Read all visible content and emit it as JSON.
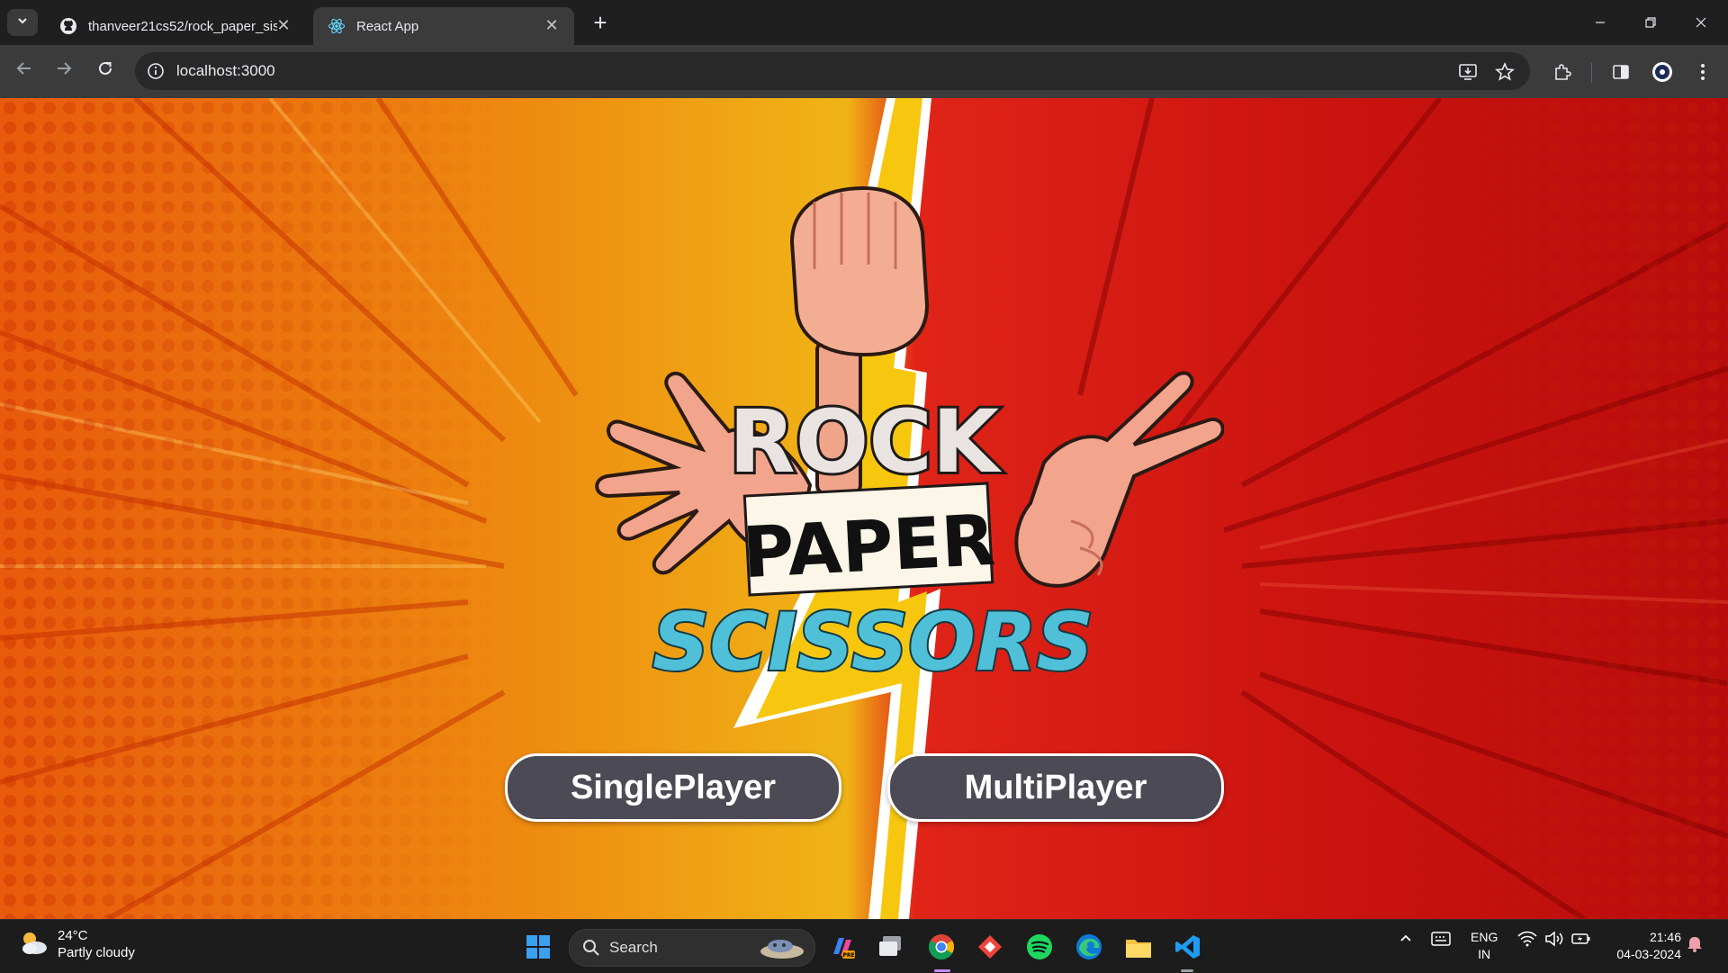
{
  "browser": {
    "tabs": [
      {
        "title": "thanveer21cs52/rock_paper_sis",
        "favicon": "github-icon",
        "active": false
      },
      {
        "title": "React App",
        "favicon": "react-icon",
        "active": true
      }
    ],
    "address": "localhost:3000"
  },
  "app": {
    "logo": {
      "line1": "ROCK",
      "line2": "PAPER",
      "line3": "SCISSORS"
    },
    "buttons": {
      "single": "SinglePlayer",
      "multi": "MultiPlayer"
    },
    "colors": {
      "left_bg": "#ee8a10",
      "right_bg": "#d01a12",
      "button_bg": "#4b4a55",
      "scissors_text": "#4fc0d8"
    }
  },
  "taskbar": {
    "weather": {
      "temp": "24°C",
      "desc": "Partly cloudy"
    },
    "search_label": "Search",
    "lang": {
      "line1": "ENG",
      "line2": "IN"
    },
    "clock": {
      "time": "21:46",
      "date": "04-03-2024"
    }
  }
}
